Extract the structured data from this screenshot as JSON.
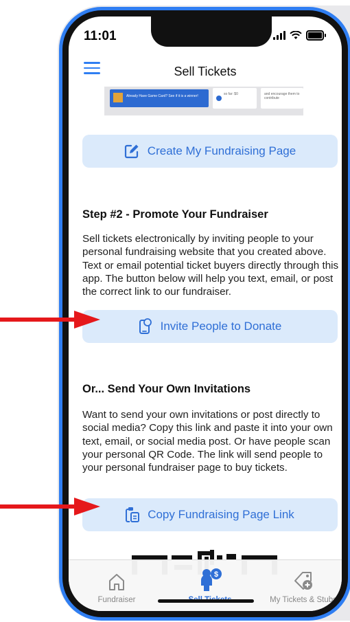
{
  "status_bar": {
    "time": "11:01"
  },
  "nav": {
    "title": "Sell Tickets"
  },
  "preview": {
    "card1_text": "Already Have Game Card? See if it is a winner!",
    "card2_text": "so far: $0",
    "card3_text": "and encourage them to contribute"
  },
  "buttons": {
    "create_page": "Create My Fundraising Page",
    "invite": "Invite People to Donate",
    "copy_link": "Copy Fundraising Page Link"
  },
  "step2": {
    "title": "Step #2 - Promote Your Fundraiser",
    "body": "Sell tickets electronically by inviting people to your personal fundraising website that you created above. Text or email potential ticket buyers directly through this app. The button below will help you text, email, or post the correct link to our fundraiser."
  },
  "own": {
    "title": "Or... Send Your Own Invitations",
    "body": "Want to send your own invitations or post directly to social media? Copy this link and paste it into your own text, email, or social media post. Or have people scan your personal QR Code. The link will send people to your personal fundraiser page to buy tickets."
  },
  "tabs": [
    {
      "label": "Fundraiser",
      "icon": "home-icon",
      "active": false
    },
    {
      "label": "Sell Tickets",
      "icon": "person-dollar-icon",
      "active": true
    },
    {
      "label": "My Tickets & Stubs",
      "icon": "tag-plus-icon",
      "active": false
    }
  ],
  "colors": {
    "accent": "#2f6fd6",
    "button_bg": "#dbeafb",
    "frame": "#2f7ef2",
    "arrow": "#e5181b"
  }
}
